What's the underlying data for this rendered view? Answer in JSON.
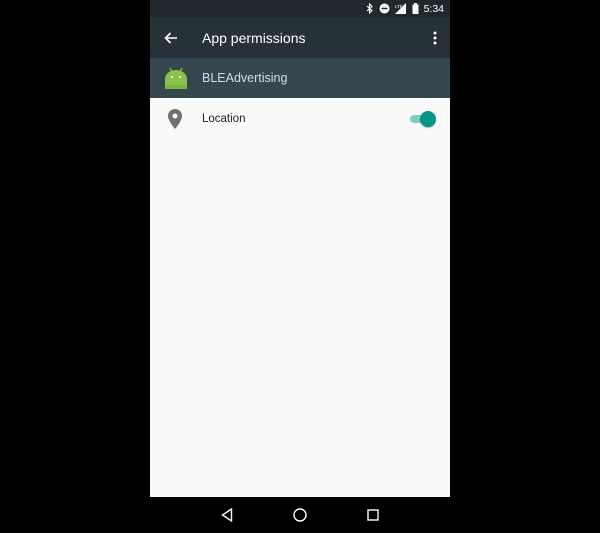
{
  "status_bar": {
    "time": "5:34",
    "icons": [
      "bluetooth-icon",
      "do-not-disturb-icon",
      "signal-lte-icon",
      "battery-icon"
    ],
    "network_label": "LTE"
  },
  "toolbar": {
    "title": "App permissions",
    "back_icon": "arrow-back-icon",
    "menu_icon": "more-vert-icon"
  },
  "app": {
    "name": "BLEAdvertising",
    "icon": "android-icon"
  },
  "permissions": [
    {
      "label": "Location",
      "icon": "location-pin-icon",
      "enabled": true
    }
  ],
  "colors": {
    "toolbar": "#263238",
    "app_header": "#37474f",
    "accent": "#009688"
  },
  "nav_bar": {
    "buttons": [
      "back-icon",
      "home-icon",
      "recents-icon"
    ]
  }
}
